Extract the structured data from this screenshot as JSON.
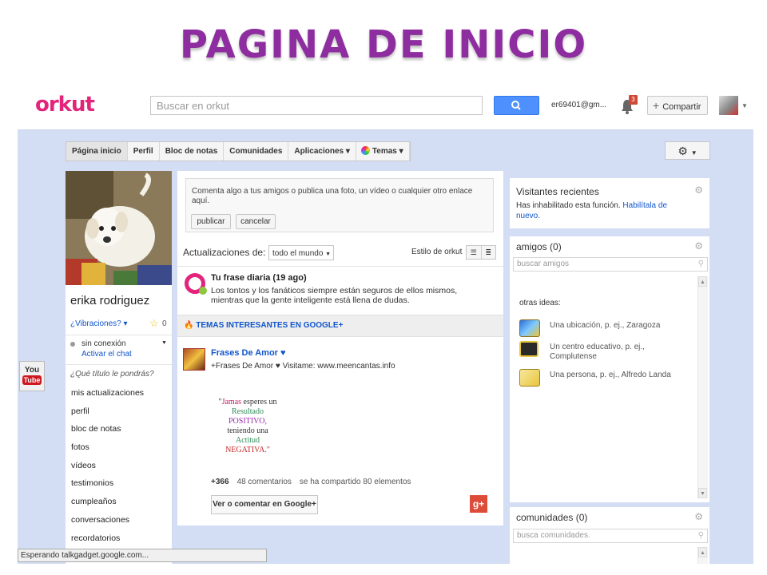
{
  "slide": {
    "title": "PAGINA DE INICIO"
  },
  "topbar": {
    "logo": "orkut",
    "search_placeholder": "Buscar en orkut",
    "email": "er69401@gm...",
    "notification_count": "3",
    "share_label": "Compartir"
  },
  "nav": {
    "tabs": [
      "Página inicio",
      "Perfil",
      "Bloc de notas",
      "Comunidades",
      "Aplicaciones ▾",
      "Temas ▾"
    ]
  },
  "profile": {
    "name": "erika rodriguez",
    "vibrations": "¿Vibraciones? ▾",
    "star_count": "0",
    "status": "sin conexión",
    "chat_link": "Activar el chat",
    "title_prompt": "¿Qué título le pondrás?",
    "menu": [
      "mis actualizaciones",
      "perfil",
      "bloc de notas",
      "fotos",
      "vídeos",
      "testimonios",
      "cumpleaños",
      "conversaciones",
      "recordatorios"
    ]
  },
  "composer": {
    "placeholder": "Comenta algo a tus amigos o publica una foto, un vídeo o cualquier otro enlace aquí.",
    "publish": "publicar",
    "cancel": "cancelar"
  },
  "updates": {
    "label": "Actualizaciones de:",
    "filter": "todo el mundo",
    "style_label": "Estilo de orkut"
  },
  "daily": {
    "title": "Tu frase diaria (19 ago)",
    "text": "Los tontos y los fanáticos siempre están seguros de ellos mismos, mientras que la gente inteligente está llena de dudas."
  },
  "interesting": {
    "label": "TEMAS INTERESANTES EN GOOGLE+"
  },
  "post": {
    "author": "Frases De Amor ♥",
    "subtitle": "+Frases De Amor ♥ Visitame: www.meencantas.info",
    "quote": {
      "l1a": "\"",
      "l1b": "Jamas",
      "l1c": " esperes un",
      "l2": "Resultado",
      "l3": "POSITIVO,",
      "l4": "teniendo una",
      "l5": "Actitud",
      "l6": "NEGATIVA.\""
    },
    "plus": "+366",
    "comments": "48 comentarios",
    "shared": "se ha compartido 80 elementos",
    "view_button": "Ver o comentar en Google+",
    "gplus_label": "g+"
  },
  "visitors": {
    "title": "Visitantes recientes",
    "text": "Has inhabilitado esta función.",
    "link": "Habilítala de nuevo."
  },
  "friends": {
    "title": "amigos (0)",
    "search_placeholder": "buscar amigos",
    "ideas_label": "otras ideas:",
    "ideas": [
      {
        "text": "Una ubicación, p. ej., Zaragoza"
      },
      {
        "text": "Un centro educativo, p. ej., Complutense"
      },
      {
        "text": "Una persona, p. ej., Alfredo Landa"
      }
    ]
  },
  "communities": {
    "title": "comunidades (0)",
    "search_placeholder": "busca comunidades."
  },
  "youtube": {
    "top": "You",
    "bottom": "Tube"
  },
  "status_bar": "Esperando talkgadget.google.com...",
  "colors": {
    "brand": "#e2247b",
    "link": "#1155cc",
    "background": "#d3def5",
    "title": "#8e2da0"
  }
}
